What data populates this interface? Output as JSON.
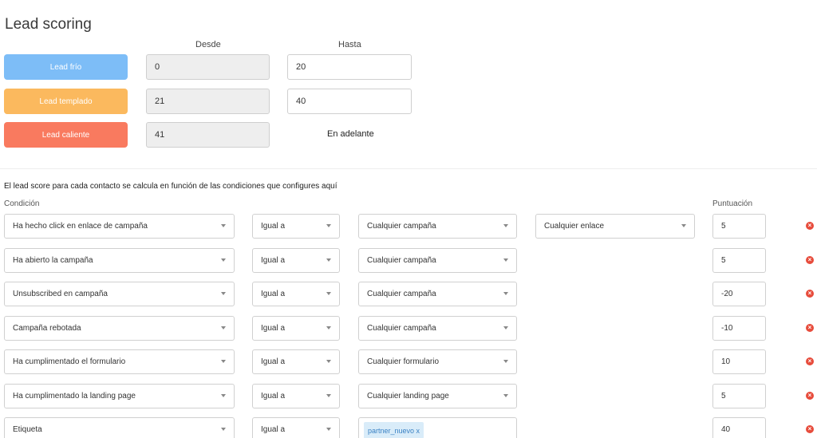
{
  "page": {
    "title": "Lead scoring"
  },
  "ranges": {
    "from_label": "Desde",
    "to_label": "Hasta",
    "tiers": [
      {
        "label": "Lead frío",
        "color": "#7dbdf7",
        "from": "0",
        "to": "20"
      },
      {
        "label": "Lead templado",
        "color": "#fbb95e",
        "from": "21",
        "to": "40"
      },
      {
        "label": "Lead caliente",
        "color": "#f97a5f",
        "from": "41",
        "to_text": "En adelante"
      }
    ]
  },
  "rules": {
    "intro": "El lead score para cada contacto se calcula en función de las condiciones que configures aquí",
    "condition_label": "Condición",
    "score_label": "Puntuación",
    "items": [
      {
        "condition": "Ha hecho click en enlace de campaña",
        "operator": "Igual a",
        "value": "Cualquier campaña",
        "extra": "Cualquier enlace",
        "score": "5"
      },
      {
        "condition": "Ha abierto la campaña",
        "operator": "Igual a",
        "value": "Cualquier campaña",
        "score": "5"
      },
      {
        "condition": "Unsubscribed en campaña",
        "operator": "Igual a",
        "value": "Cualquier campaña",
        "score": "-20"
      },
      {
        "condition": "Campaña rebotada",
        "operator": "Igual a",
        "value": "Cualquier campaña",
        "score": "-10"
      },
      {
        "condition": "Ha cumplimentado el formulario",
        "operator": "Igual a",
        "value": "Cualquier formulario",
        "score": "10"
      },
      {
        "condition": "Ha cumplimentado la landing page",
        "operator": "Igual a",
        "value": "Cualquier landing page",
        "score": "5"
      },
      {
        "condition": "Etiqueta",
        "operator": "Igual a",
        "tag": "partner_nuevo x",
        "score": "40"
      }
    ],
    "remove_icon": "close-circle-icon"
  },
  "colors": {
    "remove": "#e74c3c",
    "tag_bg": "#d9ecf9",
    "tag_text": "#3b82c4"
  }
}
